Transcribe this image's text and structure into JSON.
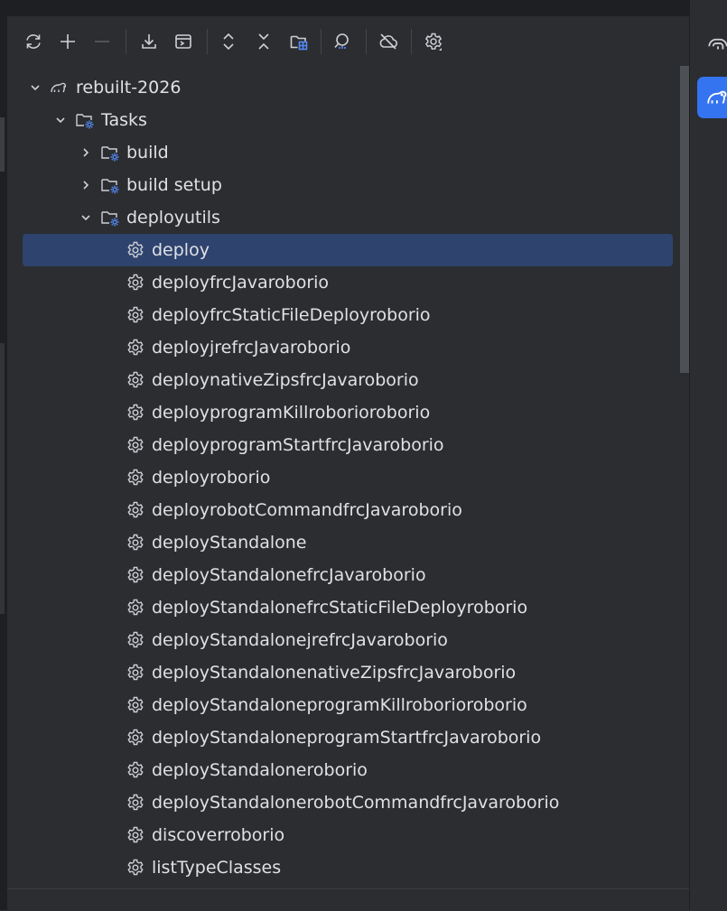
{
  "toolbar": {
    "buttons": [
      {
        "name": "reload-all-icon"
      },
      {
        "name": "add-icon"
      },
      {
        "name": "remove-icon"
      },
      {
        "name": "download-sources-icon"
      },
      {
        "name": "run-task-icon"
      },
      {
        "name": "expand-all-icon"
      },
      {
        "name": "collapse-all-icon"
      },
      {
        "name": "group-modules-icon"
      },
      {
        "name": "analyze-dependencies-icon"
      },
      {
        "name": "offline-mode-icon"
      },
      {
        "name": "settings-icon"
      }
    ]
  },
  "tree": {
    "project": "rebuilt-2026",
    "tasks_folder": "Tasks",
    "groups": [
      "build",
      "build setup",
      "deployutils"
    ],
    "tasks": [
      "deploy",
      "deployfrcJavaroborio",
      "deployfrcStaticFileDeployroborio",
      "deployjrefrcJavaroborio",
      "deploynativeZipsfrcJavaroborio",
      "deployprogramKillroborioroborio",
      "deployprogramStartfrcJavaroborio",
      "deployroborio",
      "deployrobotCommandfrcJavaroborio",
      "deployStandalone",
      "deployStandalonefrcJavaroborio",
      "deployStandalonefrcStaticFileDeployroborio",
      "deployStandalonejrefrcJavaroborio",
      "deployStandalonenativeZipsfrcJavaroborio",
      "deployStandaloneprogramKillroborioroborio",
      "deployStandaloneprogramStartfrcJavaroborio",
      "deployStandaloneroborio",
      "deployStandalonerobotCommandfrcJavaroborio",
      "discoverroborio",
      "listTypeClasses"
    ],
    "selected": "deploy"
  },
  "right_rail": [
    {
      "name": "ai-assistant-icon"
    },
    {
      "name": "gradle-elephant-icon",
      "active": true
    }
  ],
  "colors": {
    "background": "#2b2d30",
    "selection": "#2e436e",
    "accent": "#3574f0",
    "text": "#dfe1e5",
    "icon": "#ced0d6"
  }
}
